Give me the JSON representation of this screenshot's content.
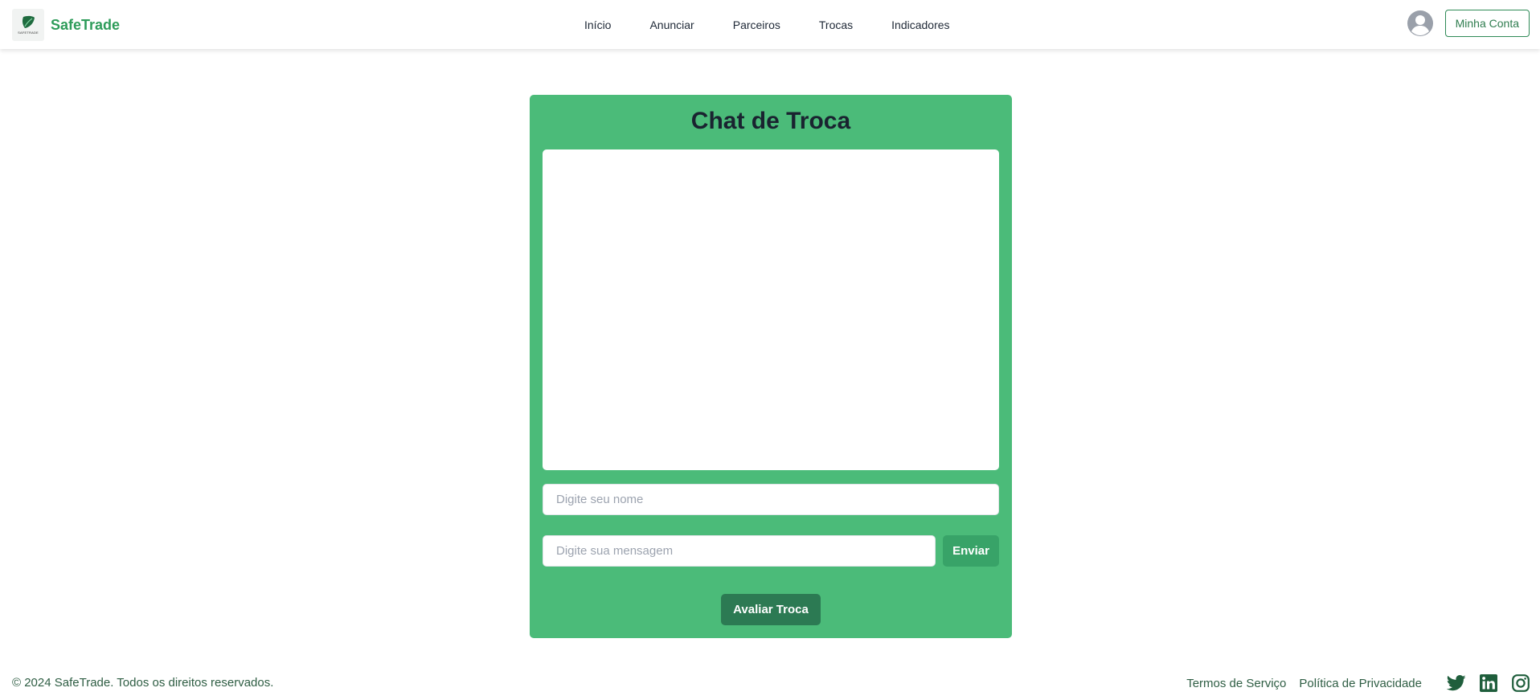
{
  "brand": {
    "name": "SafeTrade",
    "logo_text": "SAFETRADE",
    "color": "#2e9c5a"
  },
  "nav": {
    "items": [
      "Início",
      "Anunciar",
      "Parceiros",
      "Trocas",
      "Indicadores"
    ]
  },
  "account": {
    "avatar_icon": "user-circle-icon",
    "button_label": "Minha Conta"
  },
  "chat": {
    "title": "Chat de Troca",
    "name_placeholder": "Digite seu nome",
    "message_placeholder": "Digite sua mensagem",
    "send_label": "Enviar",
    "rate_label": "Avaliar Troca",
    "messages": []
  },
  "footer": {
    "copyright": "© 2024 SafeTrade. Todos os direitos reservados.",
    "links": [
      "Termos de Serviço",
      "Política de Privacidade"
    ],
    "social_icons": [
      "twitter-icon",
      "linkedin-icon",
      "instagram-icon"
    ]
  },
  "colors": {
    "card_bg": "#4bbb79",
    "send_button": "#38a368",
    "rate_button": "#2c7a53",
    "footer_text": "#2f5e44"
  }
}
